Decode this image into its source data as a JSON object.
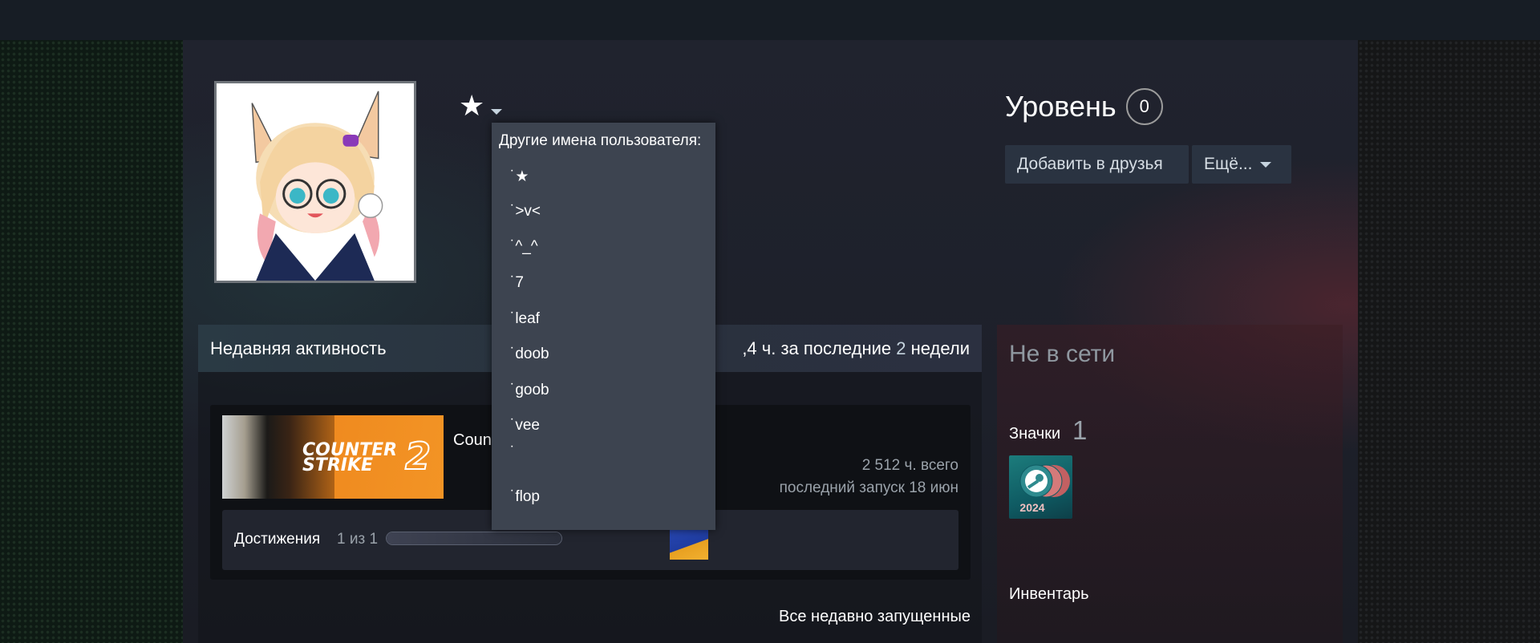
{
  "profile": {
    "name": "★",
    "level_label": "Уровень",
    "level_value": "0",
    "add_friend_label": "Добавить в друзья",
    "more_label": "Ещё..."
  },
  "aliases": {
    "header": "Другие имена пользователя:",
    "items": [
      "˙★",
      "˙>v<",
      "˙^_^",
      "˙7",
      "˙leaf",
      "˙doob",
      "˙goob",
      "˙vee",
      "˙",
      "˙flop"
    ]
  },
  "activity": {
    "title": "Недавняя активность",
    "hours_value": ",4",
    "hours_mid": " ч. за последние ",
    "hours_weeks": "2",
    "hours_suffix": " недели",
    "game_name": "Coun",
    "capsule_text": "COUNTER STRIKE",
    "capsule_number": "2",
    "total_hours": "2 512 ч. всего",
    "last_played": "последний запуск 18 июн",
    "achievements_label": "Достижения",
    "achievements_count": "1 из 1",
    "achievements_progress": 1.0,
    "all_recent_label": "Все недавно запущенные"
  },
  "sidebar": {
    "status": "Не в сети",
    "badges_label": "Значки",
    "badges_count": "1",
    "badge_year": "2024",
    "inventory_label": "Инвентарь"
  },
  "icons": {
    "name_dropdown": "caret-down-icon",
    "more_dropdown": "caret-down-icon",
    "badge": "steam-badge-icon",
    "achievement": "achievement-icon"
  },
  "colors": {
    "accent_button": "#2a3341",
    "dropdown_bg": "#3d4450",
    "status_offline": "#8f98a0"
  }
}
